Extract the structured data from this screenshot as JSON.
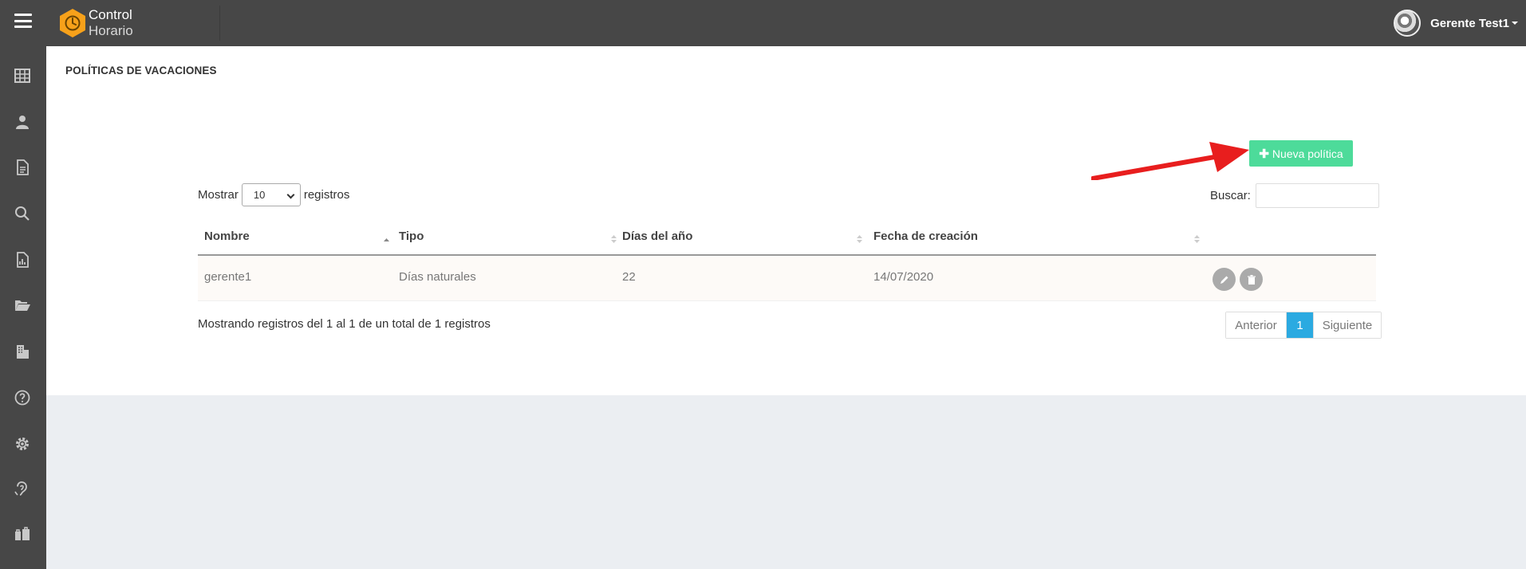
{
  "app": {
    "brand_line1": "Control",
    "brand_line2": "Horario",
    "logo_color": "#f7a11a"
  },
  "user": {
    "name": "Gerente Test1"
  },
  "sidebar": {
    "items": [
      {
        "icon": "dashboard-icon"
      },
      {
        "icon": "user-icon"
      },
      {
        "icon": "document-icon"
      },
      {
        "icon": "search-icon"
      },
      {
        "icon": "report-icon"
      },
      {
        "icon": "folder-open-icon"
      },
      {
        "icon": "building-icon"
      },
      {
        "icon": "help-icon"
      },
      {
        "icon": "gear-icon"
      },
      {
        "icon": "hearing-icon"
      },
      {
        "icon": "vacation-icon"
      }
    ]
  },
  "page": {
    "title": "POLÍTICAS DE VACACIONES"
  },
  "toolbar": {
    "new_label": "Nueva política",
    "accent": "#4ddb9a"
  },
  "table_controls": {
    "show_prefix": "Mostrar",
    "page_size": "10",
    "show_suffix": "registros",
    "search_label": "Buscar:"
  },
  "table": {
    "columns": [
      "Nombre",
      "Tipo",
      "Días del año",
      "Fecha de creación"
    ],
    "rows": [
      {
        "nombre": "gerente1",
        "tipo": "Días naturales",
        "dias": "22",
        "fecha": "14/07/2020"
      }
    ]
  },
  "footer": {
    "info": "Mostrando registros del 1 al 1 de un total de 1 registros",
    "prev": "Anterior",
    "current": "1",
    "next": "Siguiente"
  }
}
